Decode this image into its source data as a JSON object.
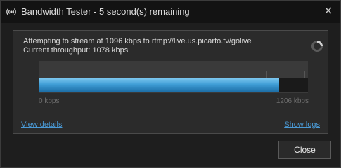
{
  "window": {
    "title": "Bandwidth Tester - 5 second(s) remaining",
    "title_icon": "broadcast-icon",
    "close_icon": "close-icon"
  },
  "status": {
    "line1": "Attempting to stream at 1096 kbps to rtmp://live.us.picarto.tv/golive",
    "line2": "Current throughput: 1078 kbps",
    "spinner_icon": "loading-spinner-icon"
  },
  "meter": {
    "min_label": "0 kbps",
    "max_label": "1206 kbps",
    "value_kbps": 1078,
    "max_kbps": 1206,
    "fill_colors": [
      "#7cc6ee",
      "#3f9ed6",
      "#1d6fa8"
    ]
  },
  "links": {
    "view_details": "View details",
    "show_logs": "Show logs"
  },
  "buttons": {
    "close_label": "Close"
  }
}
